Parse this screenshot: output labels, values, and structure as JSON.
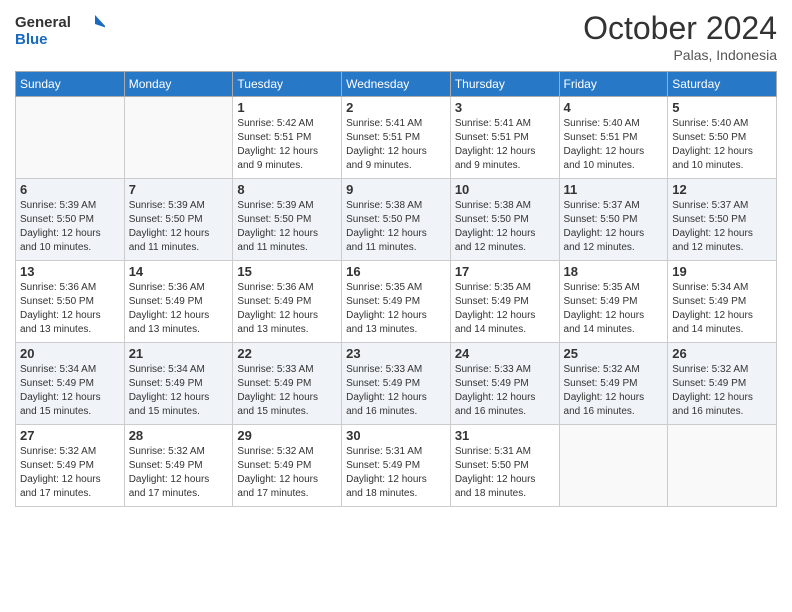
{
  "logo": {
    "text_general": "General",
    "text_blue": "Blue"
  },
  "header": {
    "month": "October 2024",
    "location": "Palas, Indonesia"
  },
  "weekdays": [
    "Sunday",
    "Monday",
    "Tuesday",
    "Wednesday",
    "Thursday",
    "Friday",
    "Saturday"
  ],
  "weeks": [
    [
      {
        "day": "",
        "info": ""
      },
      {
        "day": "",
        "info": ""
      },
      {
        "day": "1",
        "info": "Sunrise: 5:42 AM\nSunset: 5:51 PM\nDaylight: 12 hours and 9 minutes."
      },
      {
        "day": "2",
        "info": "Sunrise: 5:41 AM\nSunset: 5:51 PM\nDaylight: 12 hours and 9 minutes."
      },
      {
        "day": "3",
        "info": "Sunrise: 5:41 AM\nSunset: 5:51 PM\nDaylight: 12 hours and 9 minutes."
      },
      {
        "day": "4",
        "info": "Sunrise: 5:40 AM\nSunset: 5:51 PM\nDaylight: 12 hours and 10 minutes."
      },
      {
        "day": "5",
        "info": "Sunrise: 5:40 AM\nSunset: 5:50 PM\nDaylight: 12 hours and 10 minutes."
      }
    ],
    [
      {
        "day": "6",
        "info": "Sunrise: 5:39 AM\nSunset: 5:50 PM\nDaylight: 12 hours and 10 minutes."
      },
      {
        "day": "7",
        "info": "Sunrise: 5:39 AM\nSunset: 5:50 PM\nDaylight: 12 hours and 11 minutes."
      },
      {
        "day": "8",
        "info": "Sunrise: 5:39 AM\nSunset: 5:50 PM\nDaylight: 12 hours and 11 minutes."
      },
      {
        "day": "9",
        "info": "Sunrise: 5:38 AM\nSunset: 5:50 PM\nDaylight: 12 hours and 11 minutes."
      },
      {
        "day": "10",
        "info": "Sunrise: 5:38 AM\nSunset: 5:50 PM\nDaylight: 12 hours and 12 minutes."
      },
      {
        "day": "11",
        "info": "Sunrise: 5:37 AM\nSunset: 5:50 PM\nDaylight: 12 hours and 12 minutes."
      },
      {
        "day": "12",
        "info": "Sunrise: 5:37 AM\nSunset: 5:50 PM\nDaylight: 12 hours and 12 minutes."
      }
    ],
    [
      {
        "day": "13",
        "info": "Sunrise: 5:36 AM\nSunset: 5:50 PM\nDaylight: 12 hours and 13 minutes."
      },
      {
        "day": "14",
        "info": "Sunrise: 5:36 AM\nSunset: 5:49 PM\nDaylight: 12 hours and 13 minutes."
      },
      {
        "day": "15",
        "info": "Sunrise: 5:36 AM\nSunset: 5:49 PM\nDaylight: 12 hours and 13 minutes."
      },
      {
        "day": "16",
        "info": "Sunrise: 5:35 AM\nSunset: 5:49 PM\nDaylight: 12 hours and 13 minutes."
      },
      {
        "day": "17",
        "info": "Sunrise: 5:35 AM\nSunset: 5:49 PM\nDaylight: 12 hours and 14 minutes."
      },
      {
        "day": "18",
        "info": "Sunrise: 5:35 AM\nSunset: 5:49 PM\nDaylight: 12 hours and 14 minutes."
      },
      {
        "day": "19",
        "info": "Sunrise: 5:34 AM\nSunset: 5:49 PM\nDaylight: 12 hours and 14 minutes."
      }
    ],
    [
      {
        "day": "20",
        "info": "Sunrise: 5:34 AM\nSunset: 5:49 PM\nDaylight: 12 hours and 15 minutes."
      },
      {
        "day": "21",
        "info": "Sunrise: 5:34 AM\nSunset: 5:49 PM\nDaylight: 12 hours and 15 minutes."
      },
      {
        "day": "22",
        "info": "Sunrise: 5:33 AM\nSunset: 5:49 PM\nDaylight: 12 hours and 15 minutes."
      },
      {
        "day": "23",
        "info": "Sunrise: 5:33 AM\nSunset: 5:49 PM\nDaylight: 12 hours and 16 minutes."
      },
      {
        "day": "24",
        "info": "Sunrise: 5:33 AM\nSunset: 5:49 PM\nDaylight: 12 hours and 16 minutes."
      },
      {
        "day": "25",
        "info": "Sunrise: 5:32 AM\nSunset: 5:49 PM\nDaylight: 12 hours and 16 minutes."
      },
      {
        "day": "26",
        "info": "Sunrise: 5:32 AM\nSunset: 5:49 PM\nDaylight: 12 hours and 16 minutes."
      }
    ],
    [
      {
        "day": "27",
        "info": "Sunrise: 5:32 AM\nSunset: 5:49 PM\nDaylight: 12 hours and 17 minutes."
      },
      {
        "day": "28",
        "info": "Sunrise: 5:32 AM\nSunset: 5:49 PM\nDaylight: 12 hours and 17 minutes."
      },
      {
        "day": "29",
        "info": "Sunrise: 5:32 AM\nSunset: 5:49 PM\nDaylight: 12 hours and 17 minutes."
      },
      {
        "day": "30",
        "info": "Sunrise: 5:31 AM\nSunset: 5:49 PM\nDaylight: 12 hours and 18 minutes."
      },
      {
        "day": "31",
        "info": "Sunrise: 5:31 AM\nSunset: 5:50 PM\nDaylight: 12 hours and 18 minutes."
      },
      {
        "day": "",
        "info": ""
      },
      {
        "day": "",
        "info": ""
      }
    ]
  ]
}
